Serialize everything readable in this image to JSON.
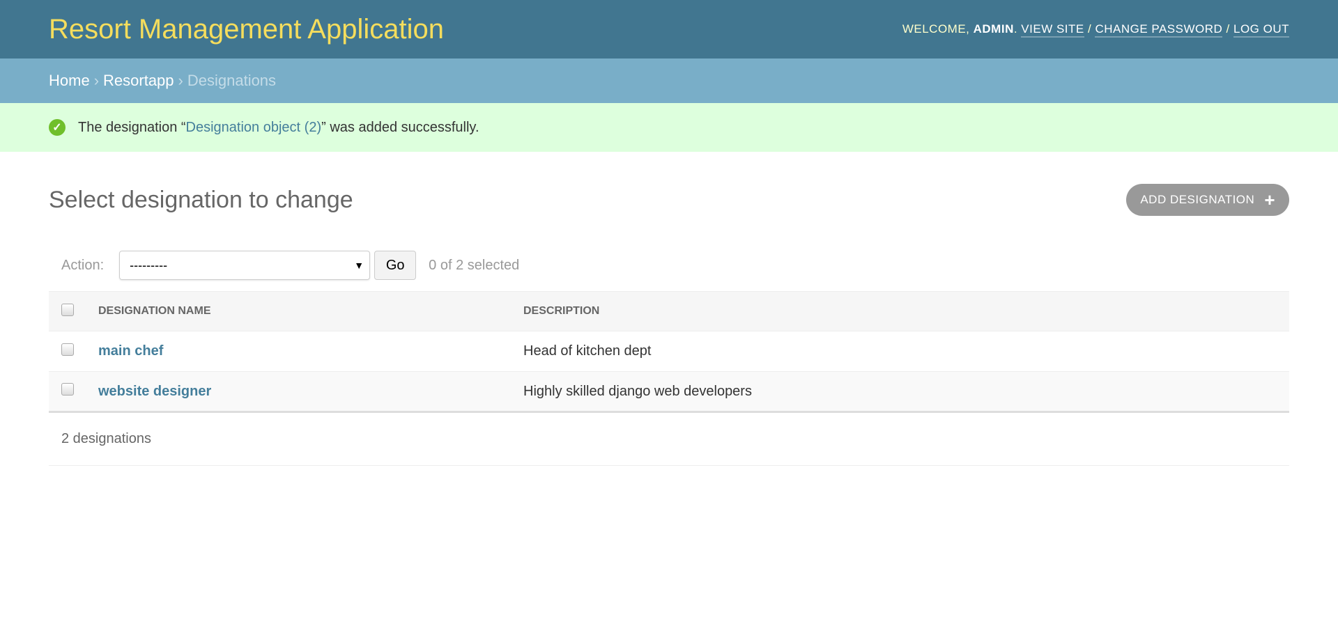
{
  "header": {
    "branding": "Resort Management Application",
    "welcome": "Welcome, ",
    "user": "admin",
    "links": [
      "View site",
      "Change password",
      "Log out"
    ]
  },
  "breadcrumbs": {
    "items": [
      "Home",
      "Resortapp"
    ],
    "current": "Designations",
    "separator": "›"
  },
  "message": {
    "prefix": "The designation “",
    "link": "Designation object (2)",
    "suffix": "” was added successfully."
  },
  "page": {
    "title": "Select designation to change",
    "add_label": "Add designation"
  },
  "actions": {
    "label": "Action:",
    "selected": "---------",
    "go": "Go",
    "counter": "0 of 2 selected"
  },
  "table": {
    "columns": [
      "Designation name",
      "Description"
    ],
    "rows": [
      {
        "name": "main chef",
        "description": "Head of kitchen dept"
      },
      {
        "name": "website designer",
        "description": "Highly skilled django web developers"
      }
    ]
  },
  "paginator": "2 designations"
}
